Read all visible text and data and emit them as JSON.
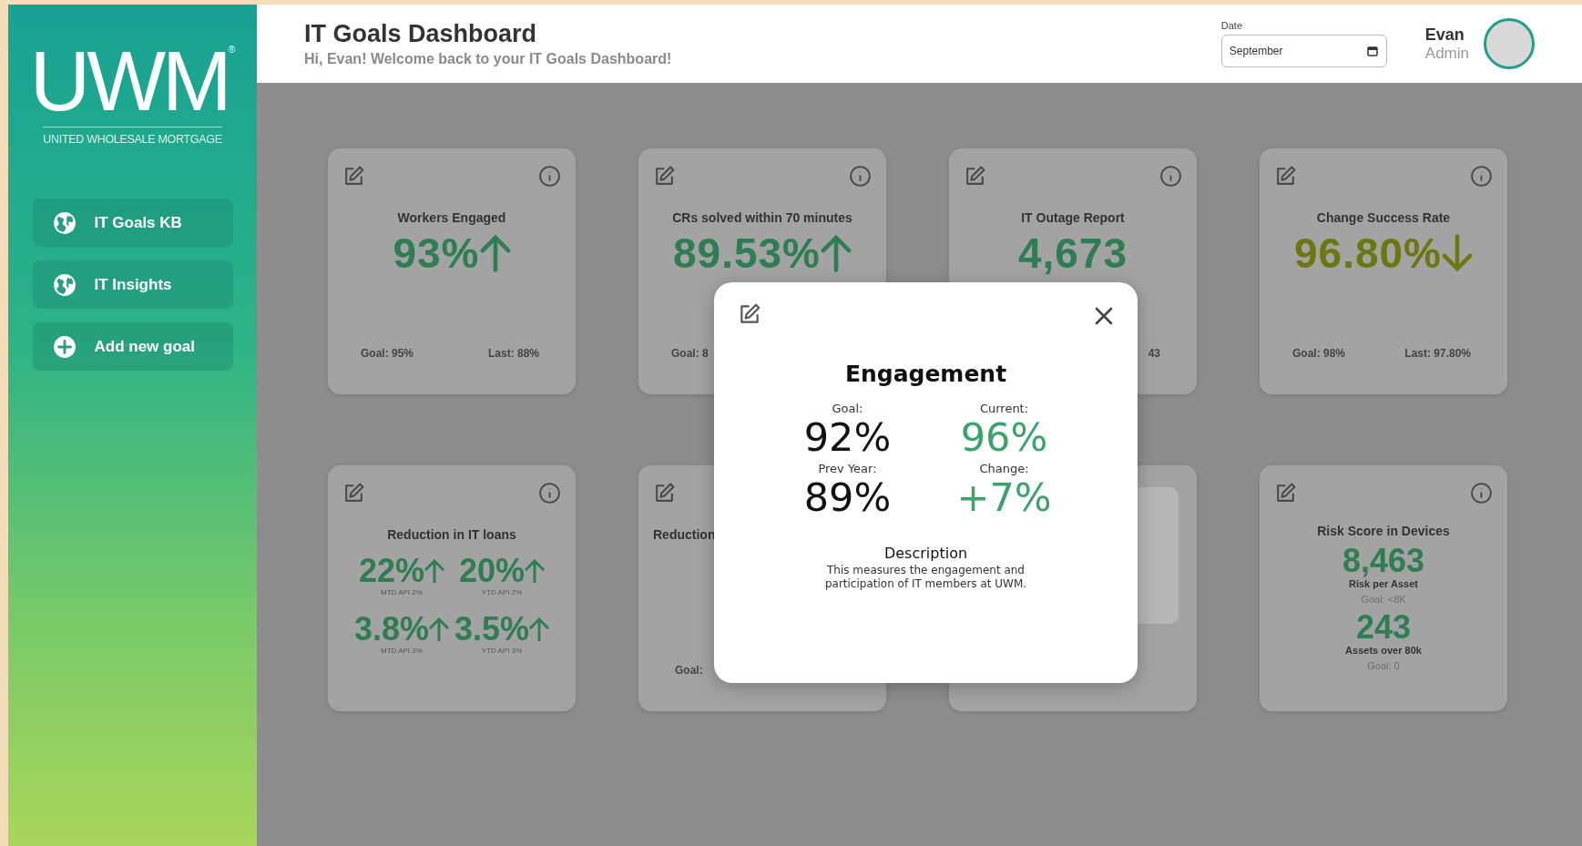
{
  "sidebar": {
    "logo": {
      "mark": "UWM",
      "registered": "®",
      "tagline": "UNITED WHOLESALE MORTGAGE"
    },
    "items": [
      {
        "label": "IT Goals KB",
        "kind": "link"
      },
      {
        "label": "IT Insights",
        "kind": "link"
      },
      {
        "label": "Add new goal",
        "kind": "action"
      }
    ]
  },
  "header": {
    "title": "IT Goals Dashboard",
    "subtitle": "Hi, Evan! Welcome back to your IT Goals Dashboard!",
    "date": {
      "label": "Date",
      "value": "September"
    },
    "user": {
      "name": "Evan",
      "role": "Admin"
    }
  },
  "cards": [
    {
      "kind": "single",
      "title": "Workers Engaged",
      "value": "93%",
      "rising": true,
      "color": "#2f7d52",
      "goal": "Goal: 95%",
      "last": "Last: 88%"
    },
    {
      "kind": "single",
      "title": "CRs solved within 70 minutes",
      "value": "89.53%",
      "rising": true,
      "color": "#2f7d52",
      "goal": "Goal: 8"
    },
    {
      "kind": "single",
      "title": "IT Outage Report",
      "value": "4,673",
      "color": "#2f7d52",
      "last": "43"
    },
    {
      "kind": "single",
      "title": "Change Success Rate",
      "value": "96.80%",
      "rising": false,
      "color": "#6b7810",
      "goal": "Goal: 98%",
      "last": "Last: 97.80%"
    },
    {
      "kind": "quad",
      "title": "Reduction in IT loans",
      "color": "#2f7d52",
      "values": [
        {
          "value": "22%",
          "rising": true,
          "sub": "MTD API 2%"
        },
        {
          "value": "20%",
          "rising": true,
          "sub": "YTD API 2%"
        },
        {
          "value": "3.8%",
          "rising": true,
          "sub": "MTD API 3%"
        },
        {
          "value": "3.5%",
          "rising": true,
          "sub": "YTD API 3%"
        }
      ]
    },
    {
      "kind": "covered",
      "title": "Reduction",
      "goal": "Goal:"
    },
    {
      "kind": "panel"
    },
    {
      "kind": "dual",
      "title": "Risk Score in Devices",
      "color": "#2f7d52",
      "values": [
        {
          "value": "8,463",
          "label": "Risk per Asset",
          "goal": "Goal: <8K"
        },
        {
          "value": "243",
          "label": "Assets over 80k",
          "goal": "Goal: 0"
        }
      ]
    }
  ],
  "modal": {
    "title": "Engagement",
    "stats": [
      {
        "label": "Goal:",
        "value": "92%",
        "color": "#111111"
      },
      {
        "label": "Current:",
        "value": "96%",
        "color": "#3aa36a"
      },
      {
        "label": "Prev Year:",
        "value": "89%",
        "color": "#111111"
      },
      {
        "label": "Change:",
        "value": "+7%",
        "color": "#3aa36a"
      }
    ],
    "description_title": "Description",
    "description": "This measures the engagement and participation of IT members at UWM."
  }
}
